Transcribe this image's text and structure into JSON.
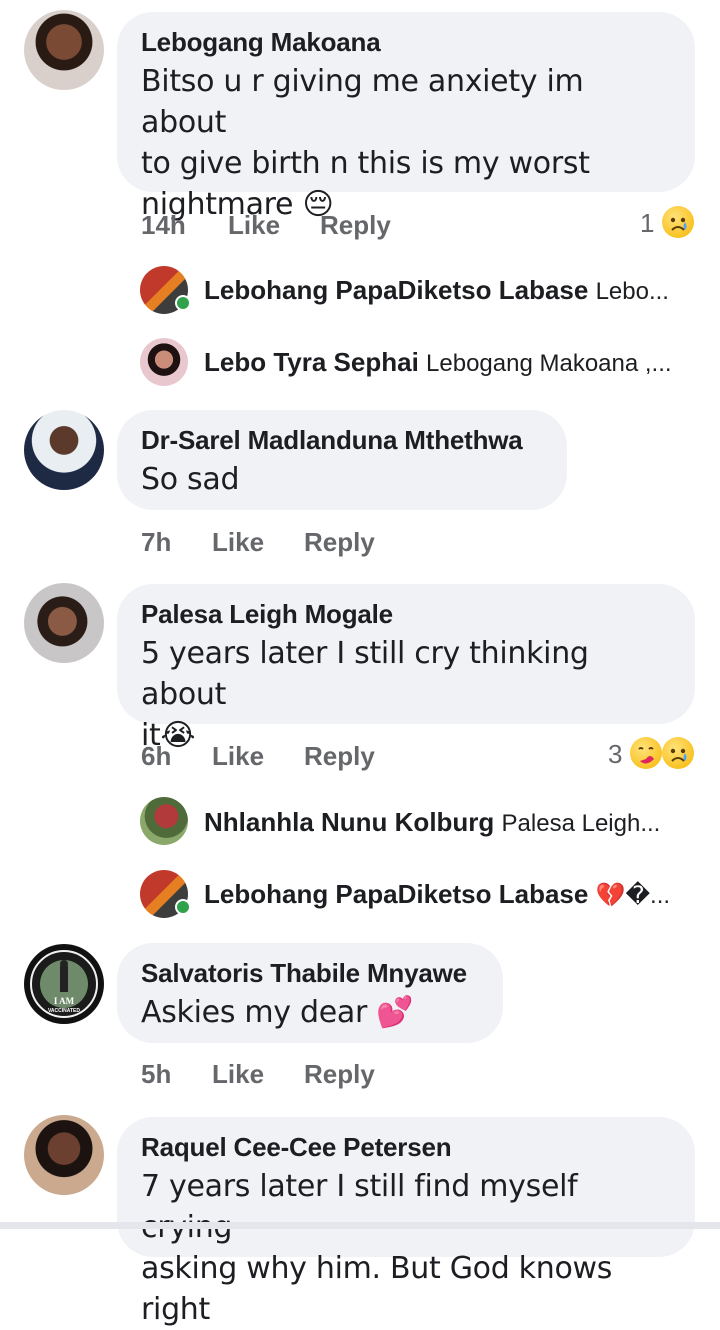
{
  "comments": [
    {
      "name": "Lebogang Makoana",
      "text_lines": [
        "Bitso u r giving me anxiety im about",
        "to give birth n this is my worst",
        "nightmare 😔"
      ],
      "time": "14h",
      "like_label": "Like",
      "reply_label": "Reply",
      "reaction_count": "1",
      "reactions": [
        "sad-emoji"
      ],
      "replies": [
        {
          "name": "Lebohang PapaDiketso Labase",
          "preview": "Lebo..."
        },
        {
          "name": "Lebo Tyra Sephai",
          "preview": "Lebogang Makoana ,..."
        }
      ]
    },
    {
      "name": "Dr-Sarel Madlanduna Mthethwa",
      "text_lines": [
        "So sad"
      ],
      "time": "7h",
      "like_label": "Like",
      "reply_label": "Reply"
    },
    {
      "name": "Palesa Leigh Mogale",
      "text_lines": [
        "5 years later I still cry thinking about",
        "it😭"
      ],
      "time": "6h",
      "like_label": "Like",
      "reply_label": "Reply",
      "reaction_count": "3",
      "reactions": [
        "care-emoji",
        "sad-emoji"
      ],
      "replies": [
        {
          "name": "Nhlanhla Nunu Kolburg",
          "preview": "Palesa Leigh..."
        },
        {
          "name": "Lebohang PapaDiketso Labase",
          "preview": "💔�..."
        }
      ]
    },
    {
      "name": "Salvatoris Thabile Mnyawe",
      "text_lines": [
        "Askies my dear 💕"
      ],
      "time": "5h",
      "like_label": "Like",
      "reply_label": "Reply",
      "avatar_text": [
        "I AM",
        "VACCINATED"
      ]
    },
    {
      "name": "Raquel Cee-Cee Petersen",
      "text_lines": [
        "7 years later I still find myself crying",
        "asking why him. But God knows right"
      ]
    }
  ],
  "colors": {
    "bubble": "#f0f2f5",
    "meta_text": "#65676b",
    "online": "#31a24c"
  }
}
